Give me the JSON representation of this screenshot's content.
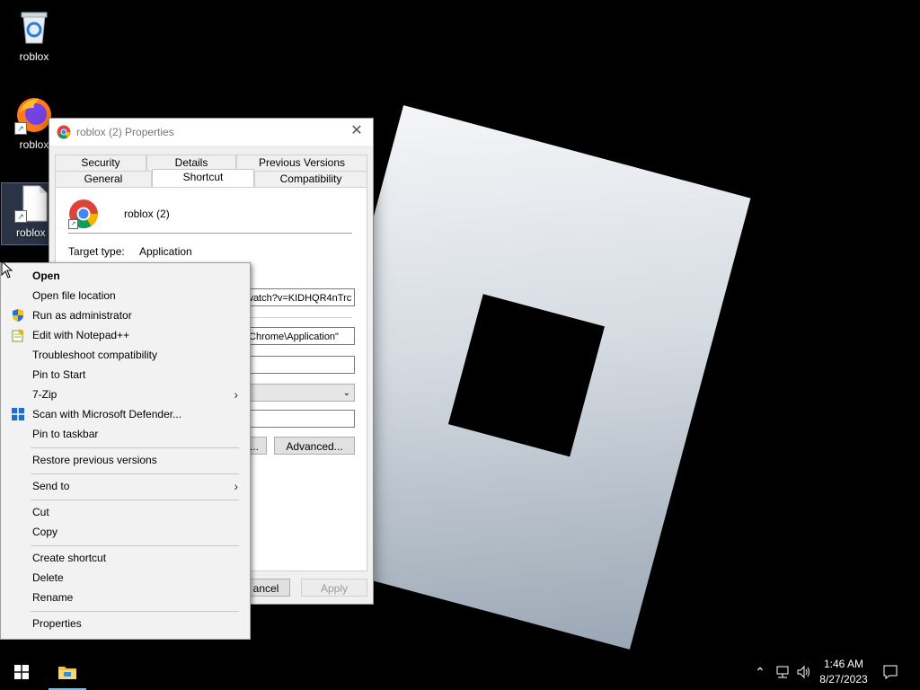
{
  "desktop": {
    "icons": [
      {
        "label": "roblox"
      },
      {
        "label": "roblox"
      },
      {
        "label": "roblox ("
      }
    ]
  },
  "dialog": {
    "title": "roblox (2) Properties",
    "tabs_top": [
      "Security",
      "Details",
      "Previous Versions"
    ],
    "tabs_bottom": [
      "General",
      "Shortcut",
      "Compatibility"
    ],
    "active_tab": "Shortcut",
    "shortcut_name": "roblox (2)",
    "target_type_label": "Target type:",
    "target_type_value": "Application",
    "target_value": "watch?v=KIDHQR4nTrc",
    "start_in_value": "\\Chrome\\Application\"",
    "shortcut_key_value": "",
    "run_value": "",
    "comment_value": "",
    "change_icon_label": "...",
    "advanced_label": "Advanced...",
    "cancel_label": "ancel",
    "apply_label": "Apply"
  },
  "context_menu": {
    "items": [
      {
        "label": "Open",
        "icon": ""
      },
      {
        "label": "Open file location",
        "icon": ""
      },
      {
        "label": "Run as administrator",
        "icon": "uac-shield-icon"
      },
      {
        "label": "Edit with Notepad++",
        "icon": "notepadpp-icon"
      },
      {
        "label": "Troubleshoot compatibility",
        "icon": ""
      },
      {
        "label": "Pin to Start",
        "icon": ""
      },
      {
        "label": "7-Zip",
        "icon": "",
        "submenu": true
      },
      {
        "label": "Scan with Microsoft Defender...",
        "icon": "defender-icon"
      },
      {
        "label": "Pin to taskbar",
        "icon": ""
      },
      {
        "label": "Restore previous versions",
        "icon": ""
      },
      {
        "label": "Send to",
        "icon": "",
        "submenu": true
      },
      {
        "label": "Cut",
        "icon": ""
      },
      {
        "label": "Copy",
        "icon": ""
      },
      {
        "label": "Create shortcut",
        "icon": ""
      },
      {
        "label": "Delete",
        "icon": ""
      },
      {
        "label": "Rename",
        "icon": ""
      },
      {
        "label": "Properties",
        "icon": ""
      }
    ]
  },
  "taskbar": {
    "time": "1:46 AM",
    "date": "8/27/2023"
  },
  "colors": {
    "desktop_bg": "#000000",
    "menu_bg": "#f2f2f2",
    "taskbar_bg": "#000000",
    "accent_blue": "#1a73e8"
  }
}
